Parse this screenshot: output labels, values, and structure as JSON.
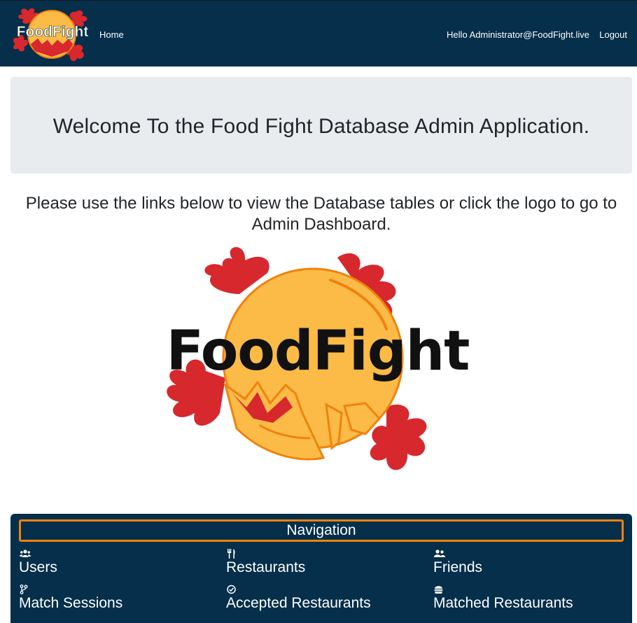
{
  "navbar": {
    "brand": "FoodFight",
    "home_label": "Home",
    "greeting": "Hello Administrator@FoodFight.live",
    "logout_label": "Logout"
  },
  "welcome": {
    "title": "Welcome To the Food Fight Database Admin Application."
  },
  "instructions": {
    "text": "Please use the links below to view the Database tables or click the logo to go to Admin Dashboard."
  },
  "logo": {
    "text": "FoodFight"
  },
  "navigation": {
    "title": "Navigation",
    "items": [
      {
        "label": "Users",
        "icon": "users-icon"
      },
      {
        "label": "Restaurants",
        "icon": "utensils-icon"
      },
      {
        "label": "Friends",
        "icon": "friends-icon"
      },
      {
        "label": "Match Sessions",
        "icon": "code-branch-icon"
      },
      {
        "label": "Accepted Restaurants",
        "icon": "check-circle-icon"
      },
      {
        "label": "Matched Restaurants",
        "icon": "hamburger-icon"
      }
    ]
  },
  "colors": {
    "navbar_bg": "#052f4a",
    "jumbotron_bg": "#e9ecef",
    "accent_orange": "#f0820f",
    "logo_red": "#d7282d",
    "logo_yellow": "#fcbb46"
  }
}
